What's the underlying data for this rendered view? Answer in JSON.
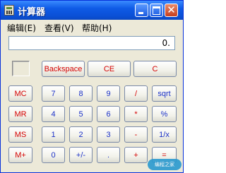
{
  "window": {
    "title": "计算器"
  },
  "menu": [
    {
      "label": "编辑(E)"
    },
    {
      "label": "查看(V)"
    },
    {
      "label": "帮助(H)"
    }
  ],
  "display": {
    "value": "0."
  },
  "buttons": {
    "backspace": "Backspace",
    "ce": "CE",
    "c": "C",
    "mc": "MC",
    "mr": "MR",
    "ms": "MS",
    "mplus": "M+",
    "n7": "7",
    "n8": "8",
    "n9": "9",
    "n4": "4",
    "n5": "5",
    "n6": "6",
    "n1": "1",
    "n2": "2",
    "n3": "3",
    "n0": "0",
    "sign": "+/-",
    "dot": ".",
    "div": "/",
    "mul": "*",
    "sub": "-",
    "add": "+",
    "sqrt": "sqrt",
    "pct": "%",
    "inv": "1/x",
    "eq": "="
  },
  "watermark": "编程之家",
  "colors": {
    "title_bar": "#0a4fd4",
    "red_label": "#d40000",
    "blue_label": "#1a30c8",
    "window_bg": "#ece9d8"
  },
  "icons": [
    "calculator-icon",
    "minimize-icon",
    "maximize-icon",
    "close-icon"
  ]
}
